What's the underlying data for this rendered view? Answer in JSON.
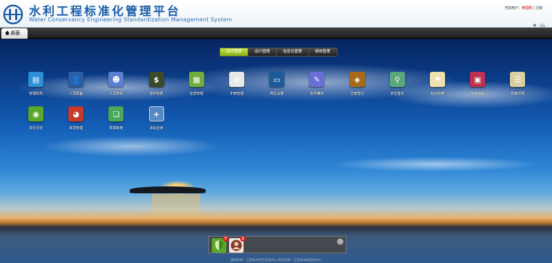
{
  "header": {
    "title_cn": "水利工程标准化管理平台",
    "title_en": "Water Conservancy Engineering Standardization Management System",
    "user_prefix": "当前用户：",
    "user_name": "黄国刚",
    "separator": " | ",
    "logout": "注销"
  },
  "tabs": {
    "home": "桌面"
  },
  "categories": [
    "运行管理",
    "运行管理",
    "信息化管理",
    "绩效管理"
  ],
  "apps": [
    {
      "label": "管理机构",
      "icon": "institution-icon",
      "color": "#2e8fd8"
    },
    {
      "label": "人员配备",
      "icon": "person-icon",
      "color": "#2a5fa8"
    },
    {
      "label": "人员培训",
      "icon": "training-icon",
      "color": "#5a7fd0"
    },
    {
      "label": "管护经费",
      "icon": "money-icon",
      "color": "#3a4a2a"
    },
    {
      "label": "巡查管理",
      "icon": "map-icon",
      "color": "#6fae3c"
    },
    {
      "label": "手册管理",
      "icon": "book-icon",
      "color": "#e8e8e8"
    },
    {
      "label": "岗位设置",
      "icon": "monitor-icon",
      "color": "#1e5a9a"
    },
    {
      "label": "划界确权",
      "icon": "edit-icon",
      "color": "#6a6fd8"
    },
    {
      "label": "注册登记",
      "icon": "certificate-icon",
      "color": "#a86a18"
    },
    {
      "label": "安全鉴定",
      "icon": "inspection-icon",
      "color": "#5aa87a"
    },
    {
      "label": "标识标牌",
      "icon": "sign-icon",
      "color": "#f0e0b0"
    },
    {
      "label": "形象面貌",
      "icon": "image-icon",
      "color": "#c03050"
    },
    {
      "label": "政策法规",
      "icon": "document-icon",
      "color": "#d8d0a0"
    },
    {
      "label": "单位评定",
      "icon": "rating-icon",
      "color": "#5aa82a"
    },
    {
      "label": "事项管理",
      "icon": "chart-icon",
      "color": "#c83a2a"
    },
    {
      "label": "规章制度",
      "icon": "rules-icon",
      "color": "#4aa85a"
    },
    {
      "label": "添加应用",
      "icon": "plus-icon",
      "color": "#7aa8d8"
    }
  ],
  "dock": [
    {
      "name": "shield-app",
      "badge": "7",
      "color": "#5aa82a"
    },
    {
      "name": "person-app",
      "badge": "1",
      "color": "#8a3a2a"
    }
  ],
  "footer": "版权所有：江苏省水利厅信息中心    技术支持：江苏省水利信息中心"
}
